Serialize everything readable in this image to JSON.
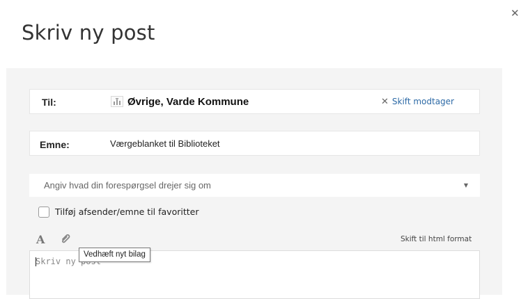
{
  "dialog": {
    "title": "Skriv ny post",
    "close_icon": "close-icon"
  },
  "recipient": {
    "label": "Til:",
    "icon": "organization-icon",
    "name": "Øvrige, Varde Kommune",
    "change_label": "Skift modtager"
  },
  "subject": {
    "label": "Emne:",
    "value": "Værgeblanket til Biblioteket"
  },
  "topic_select": {
    "placeholder": "Angiv hvad din forespørgsel drejer sig om"
  },
  "favorites": {
    "label": "Tilføj afsender/emne til favoritter",
    "checked": false
  },
  "toolbar": {
    "font_icon_glyph": "A",
    "attach_icon": "paperclip-icon",
    "html_toggle_label": "Skift til html format"
  },
  "editor": {
    "placeholder": "Skriv ny post"
  },
  "tooltip": {
    "text": "Vedhæft nyt bilag"
  },
  "colors": {
    "link": "#2d6aa6",
    "panel_background": "#f4f4f4"
  }
}
